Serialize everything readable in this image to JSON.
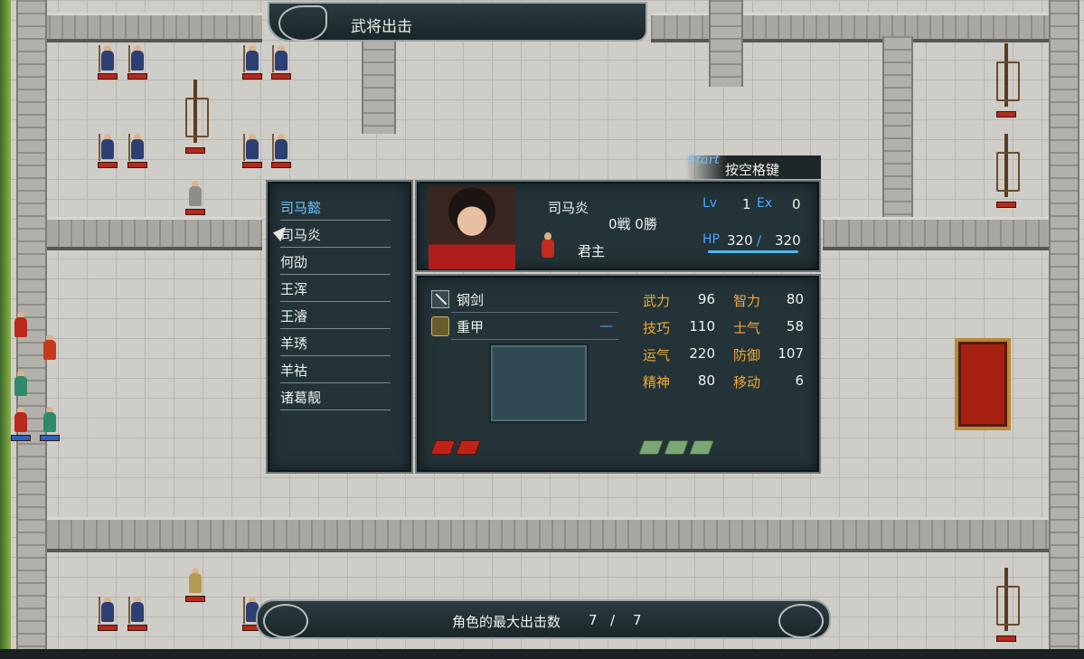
{
  "window_title": "武将出击",
  "start_hint": {
    "key_label": "Start",
    "text": "按空格键"
  },
  "roster": [
    {
      "name": "司马懿",
      "selected": true
    },
    {
      "name": "司马炎",
      "selected": false
    },
    {
      "name": "何劭",
      "selected": false
    },
    {
      "name": "王浑",
      "selected": false
    },
    {
      "name": "王濬",
      "selected": false
    },
    {
      "name": "羊琇",
      "selected": false
    },
    {
      "name": "羊祜",
      "selected": false
    },
    {
      "name": "诸葛靓",
      "selected": false
    }
  ],
  "officer": {
    "name": "司马炎",
    "record": "0戦 0勝",
    "class": "君主",
    "lv_label": "Lv",
    "lv": "1",
    "ex_label": "Ex",
    "ex": "0",
    "hp_label": "HP",
    "hp": "320",
    "hp_sep": "/",
    "hp_max": "320"
  },
  "equipment": {
    "weapon": "钢剑",
    "armor": "重甲",
    "accessory": "—"
  },
  "stats": [
    {
      "label": "武力",
      "value": "96"
    },
    {
      "label": "智力",
      "value": "80"
    },
    {
      "label": "技巧",
      "value": "110"
    },
    {
      "label": "士气",
      "value": "58"
    },
    {
      "label": "运气",
      "value": "220"
    },
    {
      "label": "防御",
      "value": "107"
    },
    {
      "label": "精神",
      "value": "80"
    },
    {
      "label": "移动",
      "value": "6"
    }
  ],
  "footer": {
    "label": "角色的最大出击数",
    "current": "7",
    "sep": "/",
    "max": "7"
  },
  "colors": {
    "accent_blue": "#4aa5ff",
    "stat_label": "#f1a83a",
    "panel": "#233337"
  }
}
